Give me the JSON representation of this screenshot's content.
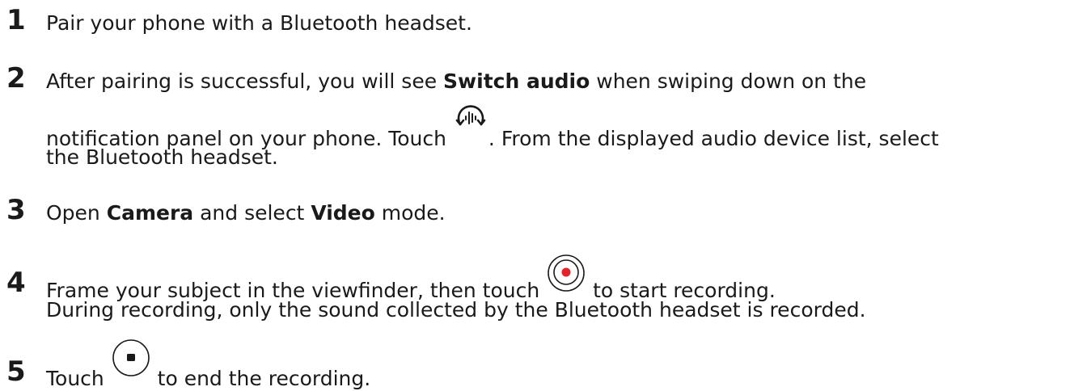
{
  "steps": [
    {
      "number": "1",
      "text": "Pair your phone with a Bluetooth headset."
    },
    {
      "number": "2",
      "line1_a": "After pairing is successful, you will see ",
      "line1_bold": "Switch audio",
      "line1_b": " when swiping down on the",
      "line2_a": "notification panel on your phone. Touch ",
      "line2_b": ". From the displayed audio device list, select",
      "line3": "the Bluetooth headset.",
      "icon": "switch-audio-icon"
    },
    {
      "number": "3",
      "a": "Open ",
      "bold1": "Camera",
      "b": " and select ",
      "bold2": "Video",
      "c": " mode."
    },
    {
      "number": "4",
      "line1_a": "Frame your subject in the viewfinder, then touch ",
      "line1_b": " to start recording.",
      "line2": "During recording, only the sound collected by the Bluetooth headset is recorded.",
      "icon": "record-button-icon",
      "icon_color": "#e8202a"
    },
    {
      "number": "5",
      "a": "Touch ",
      "b": " to end the recording.",
      "icon": "stop-button-icon"
    }
  ]
}
